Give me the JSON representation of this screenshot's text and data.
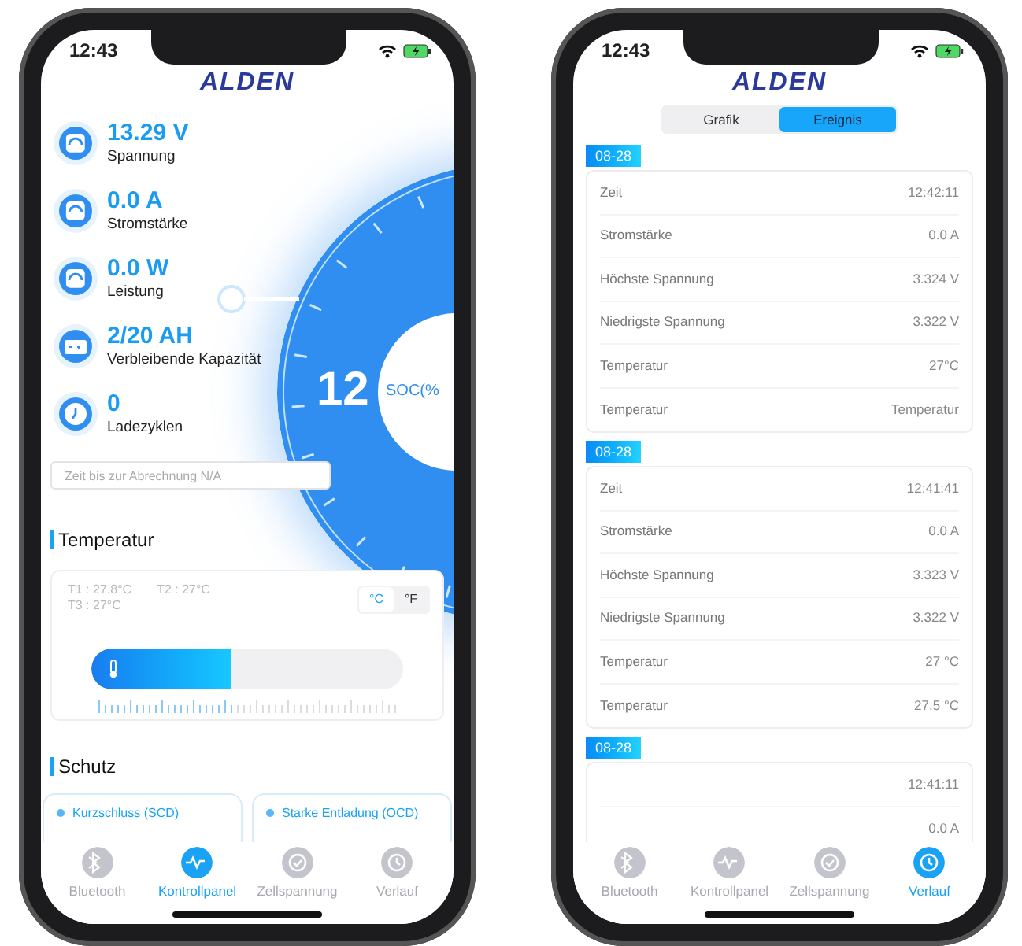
{
  "left_phone": {
    "status_bar": {
      "time": "12:43"
    },
    "logo": "ALDEN",
    "metrics": [
      {
        "value": "13.29 V",
        "label": "Spannung"
      },
      {
        "value": "0.0 A",
        "label": "Stromstärke"
      },
      {
        "value": "0.0 W",
        "label": "Leistung"
      },
      {
        "value": "2/20 AH",
        "label": "Verbleibende Kapazität"
      },
      {
        "value": "0",
        "label": "Ladezyklen"
      }
    ],
    "gauge": {
      "value": "12",
      "label": "SOC(%"
    },
    "billing_field": {
      "placeholder": "Zeit bis zur Abrechnung N/A"
    },
    "temperature": {
      "heading": "Temperatur",
      "readings": [
        "T1 : 27.8°C",
        "T2 : 27°C",
        "T3 : 27°C"
      ],
      "units": [
        {
          "label": "°C",
          "selected": true
        },
        {
          "label": "°F",
          "selected": false
        }
      ],
      "level": 0.45
    },
    "protection": {
      "heading": "Schutz",
      "items": [
        "Kurzschluss (SCD)",
        "Starke Entladung (OCD)"
      ]
    },
    "tabs": [
      {
        "label": "Bluetooth",
        "selected": false
      },
      {
        "label": "Kontrollpanel",
        "selected": true
      },
      {
        "label": "Zellspannung",
        "selected": false
      },
      {
        "label": "Verlauf",
        "selected": false
      }
    ]
  },
  "right_phone": {
    "status_bar": {
      "time": "12:43"
    },
    "logo": "ALDEN",
    "segments": [
      {
        "label": "Grafik",
        "selected": false
      },
      {
        "label": "Ereignis",
        "selected": true
      }
    ],
    "events": [
      {
        "date": "08-28",
        "rows": [
          {
            "label": "Zeit",
            "value": "12:42:11"
          },
          {
            "label": "Stromstärke",
            "value": "0.0 A"
          },
          {
            "label": "Höchste Spannung",
            "value": "3.324 V"
          },
          {
            "label": "Niedrigste Spannung",
            "value": "3.322 V"
          },
          {
            "label": "Temperatur",
            "value": "27°C"
          },
          {
            "label": "Temperatur",
            "value": "Temperatur"
          }
        ]
      },
      {
        "date": "08-28",
        "rows": [
          {
            "label": "Zeit",
            "value": "12:41:41"
          },
          {
            "label": "Stromstärke",
            "value": "0.0 A"
          },
          {
            "label": "Höchste Spannung",
            "value": "3.323 V"
          },
          {
            "label": "Niedrigste Spannung",
            "value": "3.322 V"
          },
          {
            "label": "Temperatur",
            "value": "27 °C"
          },
          {
            "label": "Temperatur",
            "value": "27.5 °C"
          }
        ]
      },
      {
        "date": "08-28",
        "rows": [
          {
            "value": "12:41:11"
          },
          {
            "value": "0.0 A"
          }
        ]
      }
    ],
    "tabs": [
      {
        "label": "Bluetooth",
        "selected": false
      },
      {
        "label": "Kontrollpanel",
        "selected": false
      },
      {
        "label": "Zellspannung",
        "selected": false
      },
      {
        "label": "Verlauf",
        "selected": true
      }
    ]
  }
}
